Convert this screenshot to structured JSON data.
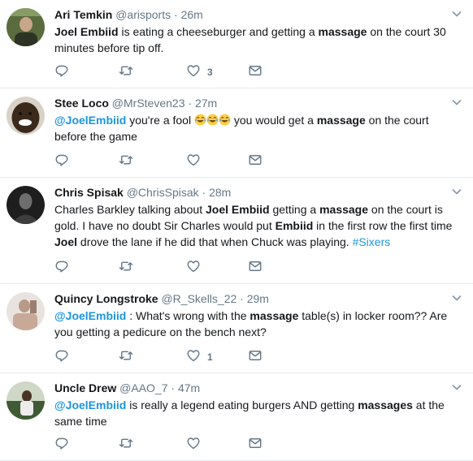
{
  "tweets": [
    {
      "name": "Ari Temkin",
      "handle": "@arisports",
      "dot": "·",
      "time": "26m",
      "segments": [
        {
          "t": "Joel Embiid",
          "s": "b"
        },
        {
          "t": " is eating a cheeseburger and getting a ",
          "s": "n"
        },
        {
          "t": "massage",
          "s": "b"
        },
        {
          "t": " on the court 30 minutes before tip off.",
          "s": "n"
        }
      ],
      "likes": "3",
      "avatar_color": "#5a6b3d"
    },
    {
      "name": "Stee Loco",
      "handle": "@MrSteven23",
      "dot": "·",
      "time": "27m",
      "segments": [
        {
          "t": "@JoelEmbiid",
          "s": "m"
        },
        {
          "t": " you're a fool ",
          "s": "n"
        },
        {
          "t": "😂😂😂",
          "s": "e"
        },
        {
          "t": " you would get a ",
          "s": "n"
        },
        {
          "t": "massage",
          "s": "b"
        },
        {
          "t": " on the court before the game",
          "s": "n"
        }
      ],
      "likes": "",
      "avatar_color": "#3b2a1c"
    },
    {
      "name": "Chris Spisak",
      "handle": "@ChrisSpisak",
      "dot": "·",
      "time": "28m",
      "segments": [
        {
          "t": "Charles Barkley talking about ",
          "s": "n"
        },
        {
          "t": "Joel Embiid",
          "s": "b"
        },
        {
          "t": " getting a ",
          "s": "n"
        },
        {
          "t": "massage",
          "s": "b"
        },
        {
          "t": " on the court is gold. I have no doubt Sir Charles would put ",
          "s": "n"
        },
        {
          "t": "Embiid",
          "s": "b"
        },
        {
          "t": " in the first row the first time ",
          "s": "n"
        },
        {
          "t": "Joel",
          "s": "b"
        },
        {
          "t": " drove the lane if he did that when Chuck was playing. ",
          "s": "n"
        },
        {
          "t": "#Sixers",
          "s": "h"
        }
      ],
      "likes": "",
      "avatar_color": "#1e1e1e"
    },
    {
      "name": "Quincy Longstroke",
      "handle": "@R_Skells_22",
      "dot": "·",
      "time": "29m",
      "segments": [
        {
          "t": "@JoelEmbiid",
          "s": "m"
        },
        {
          "t": " : What's wrong with the ",
          "s": "n"
        },
        {
          "t": "massage",
          "s": "b"
        },
        {
          "t": " table(s) in locker room?? Are you getting a pedicure on the bench next?",
          "s": "n"
        }
      ],
      "likes": "1",
      "avatar_color": "#b99a86"
    },
    {
      "name": "Uncle Drew",
      "handle": "@AAO_7",
      "dot": "·",
      "time": "47m",
      "segments": [
        {
          "t": "@JoelEmbiid",
          "s": "m"
        },
        {
          "t": " is really a legend eating burgers AND getting ",
          "s": "n"
        },
        {
          "t": "massages",
          "s": "b"
        },
        {
          "t": " at the same time",
          "s": "n"
        }
      ],
      "likes": "",
      "avatar_color": "#3f5a35"
    }
  ],
  "icons": {
    "reply": "reply-icon",
    "retweet": "retweet-icon",
    "like": "like-icon",
    "dm": "direct-message-icon",
    "caret": "chevron-down-icon"
  },
  "colors": {
    "icon": "#657786",
    "link": "#1b95e0",
    "divider": "#e6ecf0"
  }
}
